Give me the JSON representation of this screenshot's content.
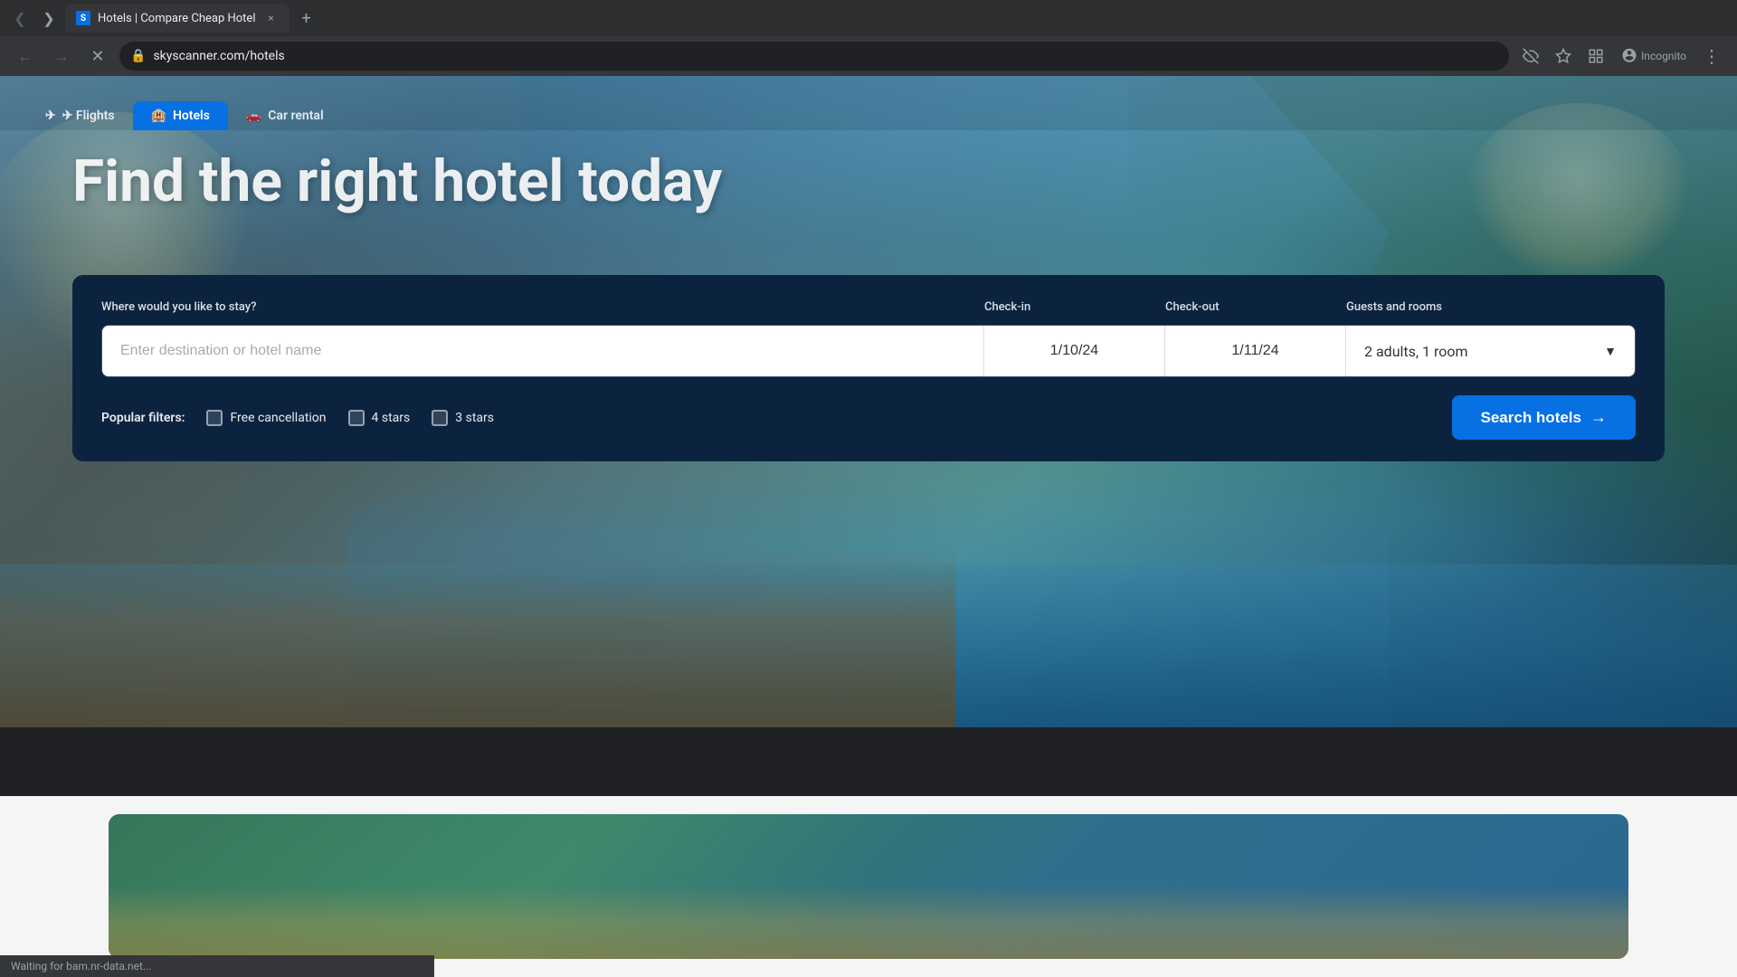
{
  "browser": {
    "tab_title": "Hotels | Compare Cheap Hotel",
    "url": "skyscanner.com/hotels",
    "favicon_letter": "S",
    "new_tab_label": "+",
    "close_tab_label": "×",
    "nav": {
      "back_icon": "←",
      "forward_icon": "→",
      "reload_icon": "↻",
      "home_icon": "⌂"
    },
    "toolbar_icons": {
      "eye_slash": "👁",
      "star": "☆",
      "tab_grid": "⊞",
      "incognito": "🕵",
      "incognito_label": "Incognito",
      "menu": "⋮"
    }
  },
  "nav_tabs": [
    {
      "id": "flights",
      "label": "✈ Flights",
      "active": false
    },
    {
      "id": "hotels",
      "label": "🏨 Hotels",
      "active": true
    },
    {
      "id": "car_rental",
      "label": "🚗 Car rental",
      "active": false
    }
  ],
  "hero": {
    "headline": "Find the right hotel today"
  },
  "search_form": {
    "destination_label": "Where would you like to stay?",
    "destination_placeholder": "Enter destination or hotel name",
    "checkin_label": "Check-in",
    "checkin_value": "1/10/24",
    "checkout_label": "Check-out",
    "checkout_value": "1/11/24",
    "guests_label": "Guests and rooms",
    "guests_value": "2 adults, 1 room",
    "dropdown_arrow": "▼",
    "filters_label": "Popular filters:",
    "filters": [
      {
        "id": "free_cancellation",
        "label": "Free cancellation",
        "checked": false
      },
      {
        "id": "4_stars",
        "label": "4 stars",
        "checked": false
      },
      {
        "id": "3_stars",
        "label": "3 stars",
        "checked": false
      }
    ],
    "search_button_label": "Search hotels",
    "search_button_arrow": "→"
  },
  "status_bar": {
    "text": "Waiting for bam.nr-data.net..."
  }
}
